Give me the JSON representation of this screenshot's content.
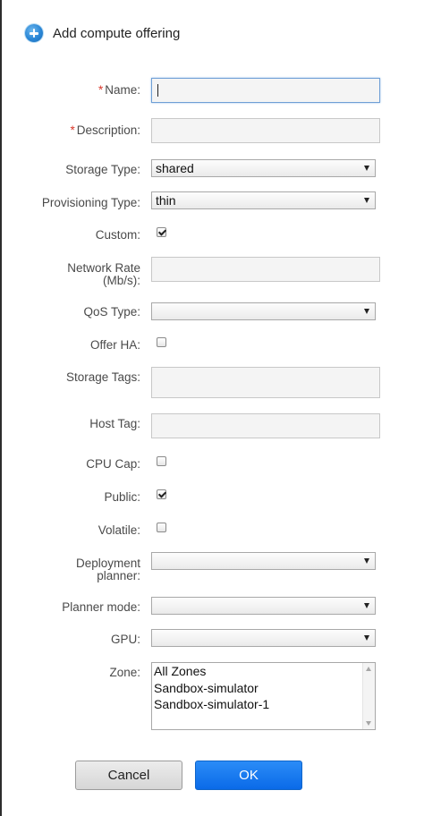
{
  "dialog": {
    "title": "Add compute offering",
    "icon": "add-circle-icon"
  },
  "form": {
    "required_marker": "*",
    "name": {
      "label": "Name:",
      "value": ""
    },
    "description": {
      "label": "Description:",
      "value": ""
    },
    "storage_type": {
      "label": "Storage Type:",
      "value": "shared"
    },
    "provisioning_type": {
      "label": "Provisioning Type:",
      "value": "thin"
    },
    "custom": {
      "label": "Custom:",
      "checked": true
    },
    "network_rate": {
      "label_line1": "Network Rate",
      "label_line2": "(Mb/s):",
      "value": ""
    },
    "qos_type": {
      "label": "QoS Type:",
      "value": ""
    },
    "offer_ha": {
      "label": "Offer HA:",
      "checked": false
    },
    "storage_tags": {
      "label": "Storage Tags:",
      "value": ""
    },
    "host_tag": {
      "label": "Host Tag:",
      "value": ""
    },
    "cpu_cap": {
      "label": "CPU Cap:",
      "checked": false
    },
    "public": {
      "label": "Public:",
      "checked": true
    },
    "volatile": {
      "label": "Volatile:",
      "checked": false
    },
    "deployment_planner": {
      "label_line1": "Deployment",
      "label_line2": "planner:",
      "value": ""
    },
    "planner_mode": {
      "label": "Planner mode:",
      "value": ""
    },
    "gpu": {
      "label": "GPU:",
      "value": ""
    },
    "zone": {
      "label": "Zone:",
      "options": [
        "All Zones",
        "Sandbox-simulator",
        "Sandbox-simulator-1"
      ]
    }
  },
  "buttons": {
    "cancel": "Cancel",
    "ok": "OK"
  },
  "colors": {
    "required": "#d9382b",
    "ok_button": "#0a6ae8",
    "focus_border": "#6f9fd6"
  }
}
